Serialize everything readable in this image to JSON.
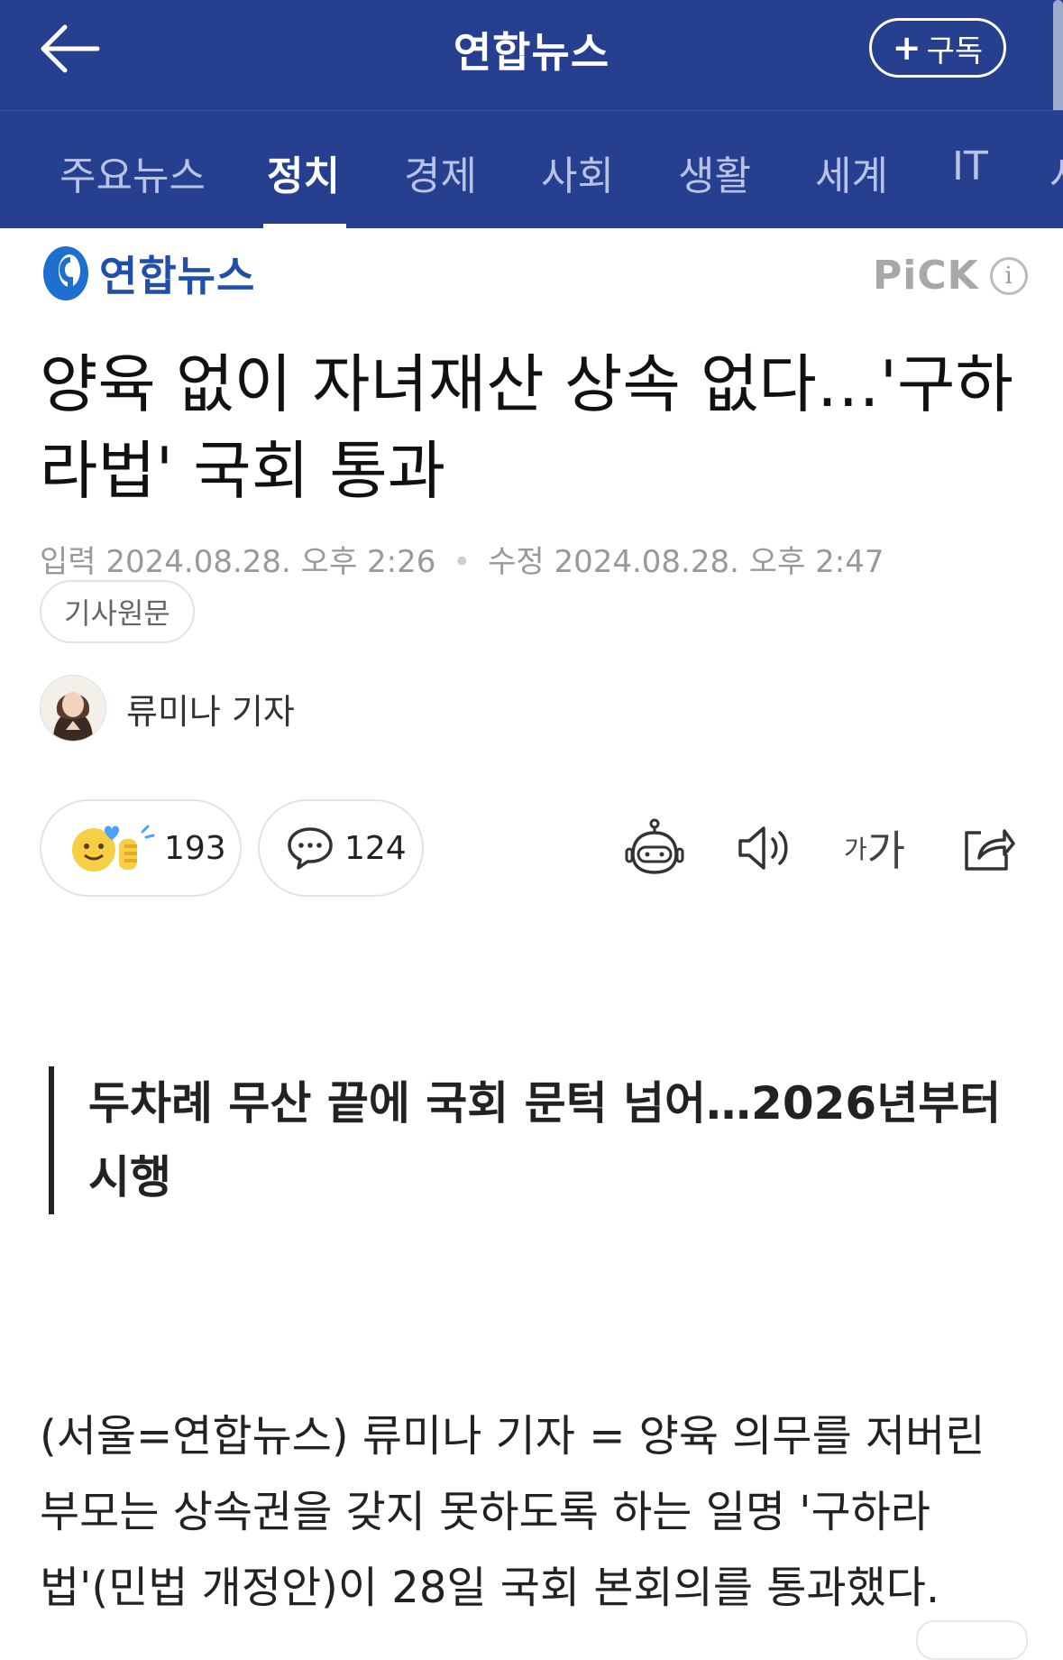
{
  "header": {
    "title": "연합뉴스",
    "subscribe_label": "구독",
    "subscribe_plus": "+"
  },
  "tabs": [
    {
      "label": "주요뉴스"
    },
    {
      "label": "정치",
      "active": true
    },
    {
      "label": "경제"
    },
    {
      "label": "사회"
    },
    {
      "label": "생활"
    },
    {
      "label": "세계"
    },
    {
      "label": "IT"
    },
    {
      "label": "사"
    }
  ],
  "press": {
    "name": "연합뉴스",
    "pick_label": "PiCK",
    "info_glyph": "i"
  },
  "article": {
    "headline": "양육 없이 자녀재산 상속 없다…'구하라법' 국회 통과",
    "input_label": "입력",
    "input_time": "2024.08.28. 오후 2:26",
    "modified_label": "수정",
    "modified_time": "2024.08.28. 오후 2:47",
    "original_button": "기사원문",
    "author": "류미나 기자",
    "reaction_count": "193",
    "comment_count": "124",
    "font_size_small": "가",
    "font_size_large": "가",
    "subheadline": "두차례 무산 끝에 국회 문턱 넘어…2026년부터 시행",
    "body": "(서울=연합뉴스) 류미나 기자 = 양육 의무를 저버린 부모는 상속권을 갖지 못하도록 하는 일명 '구하라법'(민법 개정안)이 28일 국회 본회의를 통과했다."
  },
  "colors": {
    "brand_blue": "#26408f",
    "logo_blue": "#1f4fa8"
  },
  "icons": [
    "back-arrow-icon",
    "yonhap-logo-icon",
    "info-icon",
    "reaction-emoji-icon",
    "comment-icon",
    "ai-summary-robot-icon",
    "speaker-icon",
    "share-icon"
  ]
}
